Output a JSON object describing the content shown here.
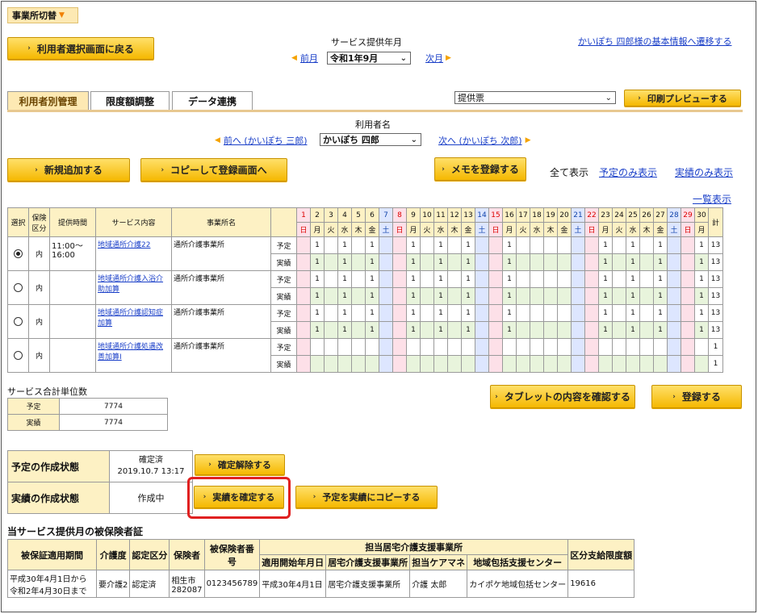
{
  "office_switch": {
    "label": "事業所切替"
  },
  "back_button": {
    "label": "利用者選択画面に戻る"
  },
  "period": {
    "title": "サービス提供年月",
    "prev": "前月",
    "current": "令和1年9月",
    "next": "次月"
  },
  "basic_info_link": "かいぽち 四郎様の基本情報へ遷移する",
  "tabs": [
    {
      "label": "利用者別管理"
    },
    {
      "label": "限度額調整"
    },
    {
      "label": "データ連携"
    }
  ],
  "report_select": {
    "value": "提供票"
  },
  "print_preview_button": {
    "label": "印刷プレビューする"
  },
  "user_nav": {
    "title": "利用者名",
    "prev": "前へ (かいぽち 三郎)",
    "current": "かいぽち 四郎",
    "next": "次へ (かいぽち 次郎)"
  },
  "buttons": {
    "add_new": "新規追加する",
    "copy_register": "コピーして登録画面へ",
    "memo": "メモを登録する",
    "tablet_check": "タブレットの内容を確認する",
    "register": "登録する",
    "unconfirm": "確定解除する",
    "confirm_actual": "実績を確定する",
    "copy_plan_to_actual": "予定を実績にコピーする"
  },
  "display_filter": {
    "all": "全て表示",
    "plan_only": "予定のみ表示",
    "actual_only": "実績のみ表示"
  },
  "list_view_link": "一覧表示",
  "schedule": {
    "headers": {
      "select": "選択",
      "insurance": "保険区分",
      "time": "提供時間",
      "service": "サービス内容",
      "office": "事業所名",
      "total": "計"
    },
    "days": [
      "1",
      "2",
      "3",
      "4",
      "5",
      "6",
      "7",
      "8",
      "9",
      "10",
      "11",
      "12",
      "13",
      "14",
      "15",
      "16",
      "17",
      "18",
      "19",
      "20",
      "21",
      "22",
      "23",
      "24",
      "25",
      "26",
      "27",
      "28",
      "29",
      "30"
    ],
    "weekdays": [
      "日",
      "月",
      "火",
      "水",
      "木",
      "金",
      "土",
      "日",
      "月",
      "火",
      "水",
      "木",
      "金",
      "土",
      "日",
      "月",
      "火",
      "水",
      "木",
      "金",
      "土",
      "日",
      "月",
      "火",
      "水",
      "木",
      "金",
      "土",
      "日",
      "月"
    ],
    "rows": [
      {
        "selected": true,
        "insurance": "内",
        "time": "11:00〜16:00",
        "service": "地域通所介護22",
        "office": "通所介護事業所",
        "plan_label": "予定",
        "actual_label": "実績",
        "plan": [
          "",
          "1",
          "",
          "1",
          "",
          "1",
          "",
          "",
          "1",
          "",
          "1",
          "",
          "1",
          "",
          "",
          "1",
          "",
          "",
          "",
          "",
          "",
          "",
          "1",
          "",
          "1",
          "",
          "1",
          "",
          "",
          "1"
        ],
        "actual": [
          "",
          "1",
          "",
          "1",
          "",
          "1",
          "",
          "",
          "1",
          "",
          "1",
          "",
          "1",
          "",
          "",
          "1",
          "",
          "",
          "",
          "",
          "",
          "",
          "1",
          "",
          "1",
          "",
          "1",
          "",
          "",
          "1"
        ],
        "plan_total": "13",
        "actual_total": "13"
      },
      {
        "selected": false,
        "insurance": "内",
        "time": "",
        "service": "地域通所介護入浴介助加算",
        "office": "通所介護事業所",
        "plan_label": "予定",
        "actual_label": "実績",
        "plan": [
          "",
          "1",
          "",
          "1",
          "",
          "1",
          "",
          "",
          "1",
          "",
          "1",
          "",
          "1",
          "",
          "",
          "1",
          "",
          "",
          "",
          "",
          "",
          "",
          "1",
          "",
          "1",
          "",
          "1",
          "",
          "",
          "1"
        ],
        "actual": [
          "",
          "1",
          "",
          "1",
          "",
          "1",
          "",
          "",
          "1",
          "",
          "1",
          "",
          "1",
          "",
          "",
          "1",
          "",
          "",
          "",
          "",
          "",
          "",
          "1",
          "",
          "1",
          "",
          "1",
          "",
          "",
          "1"
        ],
        "plan_total": "13",
        "actual_total": "13"
      },
      {
        "selected": false,
        "insurance": "内",
        "time": "",
        "service": "地域通所介護認知症加算",
        "office": "通所介護事業所",
        "plan_label": "予定",
        "actual_label": "実績",
        "plan": [
          "",
          "1",
          "",
          "1",
          "",
          "1",
          "",
          "",
          "1",
          "",
          "1",
          "",
          "1",
          "",
          "",
          "1",
          "",
          "",
          "",
          "",
          "",
          "",
          "1",
          "",
          "1",
          "",
          "1",
          "",
          "",
          "1"
        ],
        "actual": [
          "",
          "1",
          "",
          "1",
          "",
          "1",
          "",
          "",
          "1",
          "",
          "1",
          "",
          "1",
          "",
          "",
          "1",
          "",
          "",
          "",
          "",
          "",
          "",
          "1",
          "",
          "1",
          "",
          "1",
          "",
          "",
          "1"
        ],
        "plan_total": "13",
        "actual_total": "13"
      },
      {
        "selected": false,
        "insurance": "内",
        "time": "",
        "service": "地域通所介護処遇改善加算Ⅰ",
        "office": "通所介護事業所",
        "plan_label": "予定",
        "actual_label": "実績",
        "plan": [
          "",
          "",
          "",
          "",
          "",
          "",
          "",
          "",
          "",
          "",
          "",
          "",
          "",
          "",
          "",
          "",
          "",
          "",
          "",
          "",
          "",
          "",
          "",
          "",
          "",
          "",
          "",
          "",
          "",
          ""
        ],
        "actual": [
          "",
          "",
          "",
          "",
          "",
          "",
          "",
          "",
          "",
          "",
          "",
          "",
          "",
          "",
          "",
          "",
          "",
          "",
          "",
          "",
          "",
          "",
          "",
          "",
          "",
          "",
          "",
          "",
          "",
          ""
        ],
        "plan_total": "1",
        "actual_total": "1"
      }
    ]
  },
  "unit_total": {
    "title": "サービス合計単位数",
    "plan_label": "予定",
    "plan_value": "7774",
    "actual_label": "実績",
    "actual_value": "7774"
  },
  "status": {
    "plan_label": "予定の作成状態",
    "plan_state": "確定済",
    "plan_date": "2019.10.7 13:17",
    "actual_label": "実績の作成状態",
    "actual_state": "作成中"
  },
  "insurance_cert": {
    "title": "当サービス提供月の被保険者証",
    "headers": {
      "period": "被保証適用期間",
      "care_level": "介護度",
      "cert_class": "認定区分",
      "insurer": "保険者",
      "insured_no": "被保険者番号",
      "support_office": "担当居宅介護支援事業所",
      "start_date": "適用開始年月日",
      "office": "居宅介護支援事業所",
      "manager": "担当ケアマネ",
      "center": "地域包括支援センター",
      "limit": "区分支給限度額"
    },
    "row": {
      "period": "平成30年4月1日から令和2年4月30日まで",
      "care_level": "要介護2",
      "cert_class": "認定済",
      "insurer": "相生市282087",
      "insured_no": "0123456789",
      "start_date": "平成30年4月1日",
      "office": "居宅介護支援事業所",
      "manager": "介護 太郎",
      "center": "カイポケ地域包括センター",
      "limit": "19616"
    }
  }
}
